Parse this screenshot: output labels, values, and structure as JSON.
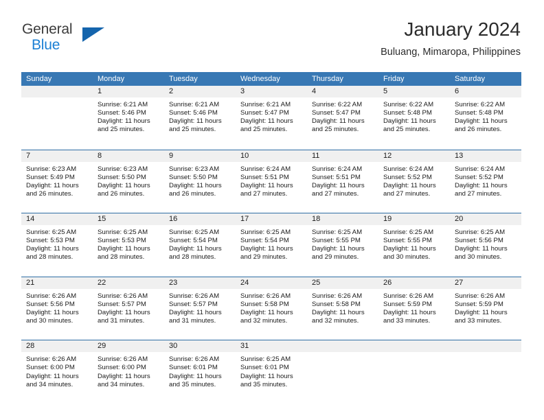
{
  "brand": {
    "line1": "General",
    "line2": "Blue",
    "triangle_color": "#1565ad",
    "blue_color": "#1b7fd4"
  },
  "header": {
    "title": "January 2024",
    "subtitle": "Buluang, Mimaropa, Philippines"
  },
  "theme": {
    "header_blue": "#3878b4",
    "row_divider_blue": "#2e6da4",
    "day_band_gray": "#f0f0f0"
  },
  "weekdays": [
    "Sunday",
    "Monday",
    "Tuesday",
    "Wednesday",
    "Thursday",
    "Friday",
    "Saturday"
  ],
  "weeks": [
    {
      "days": [
        {
          "number": "",
          "sunrise": "",
          "sunset": "",
          "daylight": "",
          "empty": true
        },
        {
          "number": "1",
          "sunrise": "Sunrise: 6:21 AM",
          "sunset": "Sunset: 5:46 PM",
          "daylight": "Daylight: 11 hours and 25 minutes.",
          "empty": false
        },
        {
          "number": "2",
          "sunrise": "Sunrise: 6:21 AM",
          "sunset": "Sunset: 5:46 PM",
          "daylight": "Daylight: 11 hours and 25 minutes.",
          "empty": false
        },
        {
          "number": "3",
          "sunrise": "Sunrise: 6:21 AM",
          "sunset": "Sunset: 5:47 PM",
          "daylight": "Daylight: 11 hours and 25 minutes.",
          "empty": false
        },
        {
          "number": "4",
          "sunrise": "Sunrise: 6:22 AM",
          "sunset": "Sunset: 5:47 PM",
          "daylight": "Daylight: 11 hours and 25 minutes.",
          "empty": false
        },
        {
          "number": "5",
          "sunrise": "Sunrise: 6:22 AM",
          "sunset": "Sunset: 5:48 PM",
          "daylight": "Daylight: 11 hours and 25 minutes.",
          "empty": false
        },
        {
          "number": "6",
          "sunrise": "Sunrise: 6:22 AM",
          "sunset": "Sunset: 5:48 PM",
          "daylight": "Daylight: 11 hours and 26 minutes.",
          "empty": false
        }
      ]
    },
    {
      "days": [
        {
          "number": "7",
          "sunrise": "Sunrise: 6:23 AM",
          "sunset": "Sunset: 5:49 PM",
          "daylight": "Daylight: 11 hours and 26 minutes.",
          "empty": false
        },
        {
          "number": "8",
          "sunrise": "Sunrise: 6:23 AM",
          "sunset": "Sunset: 5:50 PM",
          "daylight": "Daylight: 11 hours and 26 minutes.",
          "empty": false
        },
        {
          "number": "9",
          "sunrise": "Sunrise: 6:23 AM",
          "sunset": "Sunset: 5:50 PM",
          "daylight": "Daylight: 11 hours and 26 minutes.",
          "empty": false
        },
        {
          "number": "10",
          "sunrise": "Sunrise: 6:24 AM",
          "sunset": "Sunset: 5:51 PM",
          "daylight": "Daylight: 11 hours and 27 minutes.",
          "empty": false
        },
        {
          "number": "11",
          "sunrise": "Sunrise: 6:24 AM",
          "sunset": "Sunset: 5:51 PM",
          "daylight": "Daylight: 11 hours and 27 minutes.",
          "empty": false
        },
        {
          "number": "12",
          "sunrise": "Sunrise: 6:24 AM",
          "sunset": "Sunset: 5:52 PM",
          "daylight": "Daylight: 11 hours and 27 minutes.",
          "empty": false
        },
        {
          "number": "13",
          "sunrise": "Sunrise: 6:24 AM",
          "sunset": "Sunset: 5:52 PM",
          "daylight": "Daylight: 11 hours and 27 minutes.",
          "empty": false
        }
      ]
    },
    {
      "days": [
        {
          "number": "14",
          "sunrise": "Sunrise: 6:25 AM",
          "sunset": "Sunset: 5:53 PM",
          "daylight": "Daylight: 11 hours and 28 minutes.",
          "empty": false
        },
        {
          "number": "15",
          "sunrise": "Sunrise: 6:25 AM",
          "sunset": "Sunset: 5:53 PM",
          "daylight": "Daylight: 11 hours and 28 minutes.",
          "empty": false
        },
        {
          "number": "16",
          "sunrise": "Sunrise: 6:25 AM",
          "sunset": "Sunset: 5:54 PM",
          "daylight": "Daylight: 11 hours and 28 minutes.",
          "empty": false
        },
        {
          "number": "17",
          "sunrise": "Sunrise: 6:25 AM",
          "sunset": "Sunset: 5:54 PM",
          "daylight": "Daylight: 11 hours and 29 minutes.",
          "empty": false
        },
        {
          "number": "18",
          "sunrise": "Sunrise: 6:25 AM",
          "sunset": "Sunset: 5:55 PM",
          "daylight": "Daylight: 11 hours and 29 minutes.",
          "empty": false
        },
        {
          "number": "19",
          "sunrise": "Sunrise: 6:25 AM",
          "sunset": "Sunset: 5:55 PM",
          "daylight": "Daylight: 11 hours and 30 minutes.",
          "empty": false
        },
        {
          "number": "20",
          "sunrise": "Sunrise: 6:25 AM",
          "sunset": "Sunset: 5:56 PM",
          "daylight": "Daylight: 11 hours and 30 minutes.",
          "empty": false
        }
      ]
    },
    {
      "days": [
        {
          "number": "21",
          "sunrise": "Sunrise: 6:26 AM",
          "sunset": "Sunset: 5:56 PM",
          "daylight": "Daylight: 11 hours and 30 minutes.",
          "empty": false
        },
        {
          "number": "22",
          "sunrise": "Sunrise: 6:26 AM",
          "sunset": "Sunset: 5:57 PM",
          "daylight": "Daylight: 11 hours and 31 minutes.",
          "empty": false
        },
        {
          "number": "23",
          "sunrise": "Sunrise: 6:26 AM",
          "sunset": "Sunset: 5:57 PM",
          "daylight": "Daylight: 11 hours and 31 minutes.",
          "empty": false
        },
        {
          "number": "24",
          "sunrise": "Sunrise: 6:26 AM",
          "sunset": "Sunset: 5:58 PM",
          "daylight": "Daylight: 11 hours and 32 minutes.",
          "empty": false
        },
        {
          "number": "25",
          "sunrise": "Sunrise: 6:26 AM",
          "sunset": "Sunset: 5:58 PM",
          "daylight": "Daylight: 11 hours and 32 minutes.",
          "empty": false
        },
        {
          "number": "26",
          "sunrise": "Sunrise: 6:26 AM",
          "sunset": "Sunset: 5:59 PM",
          "daylight": "Daylight: 11 hours and 33 minutes.",
          "empty": false
        },
        {
          "number": "27",
          "sunrise": "Sunrise: 6:26 AM",
          "sunset": "Sunset: 5:59 PM",
          "daylight": "Daylight: 11 hours and 33 minutes.",
          "empty": false
        }
      ]
    },
    {
      "days": [
        {
          "number": "28",
          "sunrise": "Sunrise: 6:26 AM",
          "sunset": "Sunset: 6:00 PM",
          "daylight": "Daylight: 11 hours and 34 minutes.",
          "empty": false
        },
        {
          "number": "29",
          "sunrise": "Sunrise: 6:26 AM",
          "sunset": "Sunset: 6:00 PM",
          "daylight": "Daylight: 11 hours and 34 minutes.",
          "empty": false
        },
        {
          "number": "30",
          "sunrise": "Sunrise: 6:26 AM",
          "sunset": "Sunset: 6:01 PM",
          "daylight": "Daylight: 11 hours and 35 minutes.",
          "empty": false
        },
        {
          "number": "31",
          "sunrise": "Sunrise: 6:25 AM",
          "sunset": "Sunset: 6:01 PM",
          "daylight": "Daylight: 11 hours and 35 minutes.",
          "empty": false
        },
        {
          "number": "",
          "sunrise": "",
          "sunset": "",
          "daylight": "",
          "empty": true
        },
        {
          "number": "",
          "sunrise": "",
          "sunset": "",
          "daylight": "",
          "empty": true
        },
        {
          "number": "",
          "sunrise": "",
          "sunset": "",
          "daylight": "",
          "empty": true
        }
      ]
    }
  ]
}
